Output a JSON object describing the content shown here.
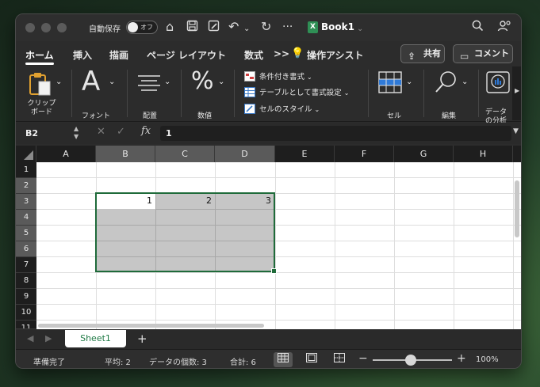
{
  "titlebar": {
    "autosave_label": "自動保存",
    "autosave_state": "オフ",
    "document_title": "Book1",
    "excel_badge": "X"
  },
  "tabs": [
    "ホーム",
    "挿入",
    "描画",
    "ページ レイアウト",
    "数式",
    ">>",
    "操作アシスト"
  ],
  "active_tab": "ホーム",
  "share_label": "共有",
  "comment_label": "コメント",
  "ribbon": {
    "clipboard": "クリップ\nボード",
    "font": "フォント",
    "font_glyph": "A",
    "alignment": "配置",
    "number": "数値",
    "number_glyph": "%",
    "conditional_format": "条件付き書式",
    "format_as_table": "テーブルとして書式設定",
    "cell_styles": "セルのスタイル",
    "cells": "セル",
    "editing": "編集",
    "data_analysis": "データ\nの分析"
  },
  "formula_bar": {
    "name_box": "B2",
    "fx_label": "fx",
    "value": "1"
  },
  "grid": {
    "columns": [
      "A",
      "B",
      "C",
      "D",
      "E",
      "F",
      "G",
      "H"
    ],
    "rows": [
      "1",
      "2",
      "3",
      "4",
      "5",
      "6",
      "7",
      "8",
      "9",
      "10",
      "11"
    ],
    "cells": {
      "B2": "1",
      "C2": "2",
      "D2": "3"
    },
    "selection": "B2:D6"
  },
  "sheet_tabs": [
    "Sheet1"
  ],
  "status": {
    "ready": "準備完了",
    "average": "平均: 2",
    "count": "データの個数: 3",
    "sum": "合計: 6",
    "zoom": "100%",
    "zoom_value_percent": 100
  },
  "colors": {
    "selection_border": "#1f6b3a",
    "sheet_tab_text": "#1f7a45",
    "header_selected": "#5a5a5a"
  }
}
